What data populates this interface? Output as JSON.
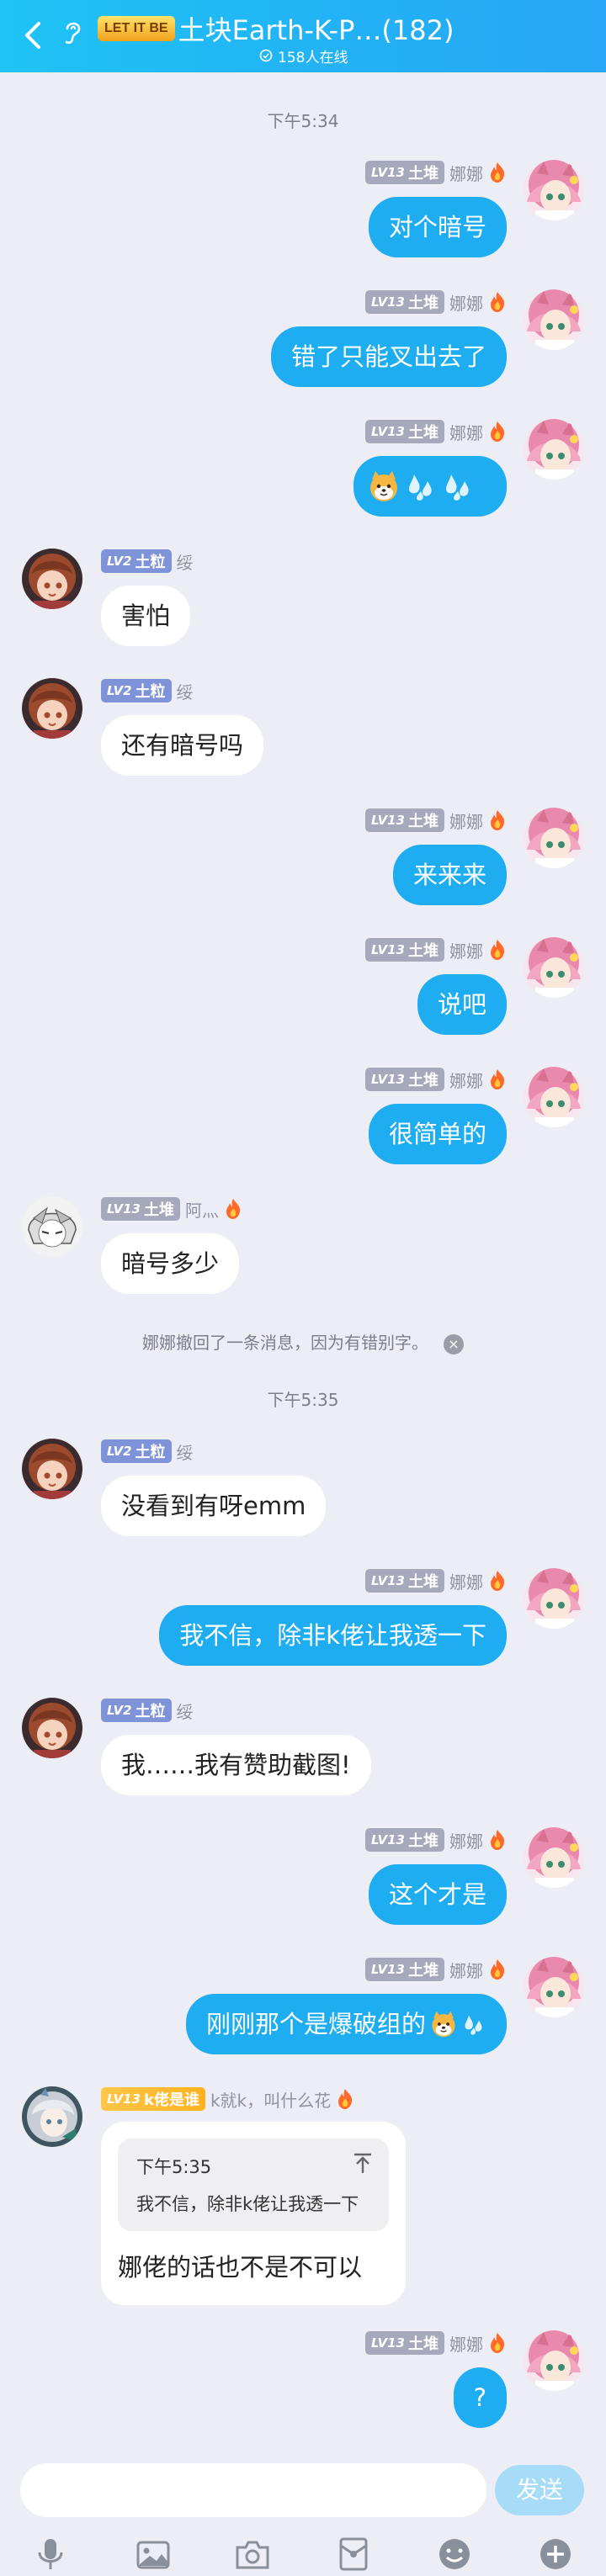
{
  "header": {
    "badge": "LET IT BE",
    "title": "土块Earth-K-P…(182)",
    "online": "158人在线"
  },
  "colors": {
    "accent": "#1FADF2",
    "header_from": "#1EC4F5",
    "bg": "#EDEEF5"
  },
  "times": {
    "t1": "下午5:34",
    "t2": "下午5:35"
  },
  "users": {
    "nana": {
      "level": "LV13",
      "title": "土堆",
      "name": "娜娜"
    },
    "sui": {
      "level": "LV2",
      "title": "土粒",
      "name": "绥"
    },
    "aji": {
      "level": "LV13",
      "title": "土堆",
      "name": "阿灬"
    },
    "kk": {
      "level": "LV13",
      "title": "k佬是谁",
      "name": "k就k，叫什么花"
    }
  },
  "messages": {
    "m1": "对个暗号",
    "m2": "错了只能叉出去了",
    "m4": "害怕",
    "m5": "还有暗号吗",
    "m6": "来来来",
    "m7": "说吧",
    "m8": "很简单的",
    "m9": "暗号多少",
    "recall": "娜娜撤回了一条消息，因为有错别字。",
    "m10": "没看到有呀emm",
    "m11": "我不信，除非k佬让我透一下",
    "m12": "我……我有赞助截图!",
    "m13": "这个才是",
    "m14": "刚刚那个是爆破组的",
    "m15_quote_time": "下午5:35",
    "m15_quote_text": "我不信，除非k佬让我透一下",
    "m15": "娜佬的话也不是不可以",
    "m16": "?"
  },
  "input": {
    "placeholder": "",
    "send_label": "发送"
  },
  "icons": [
    "back-arrow-icon",
    "ear-icon",
    "online-icon",
    "fire-icon",
    "shiba-emoji-icon",
    "sweat-drops-icon",
    "pin-icon",
    "microphone-icon",
    "image-icon",
    "camera-icon",
    "red-packet-icon",
    "emoji-icon",
    "plus-icon"
  ]
}
